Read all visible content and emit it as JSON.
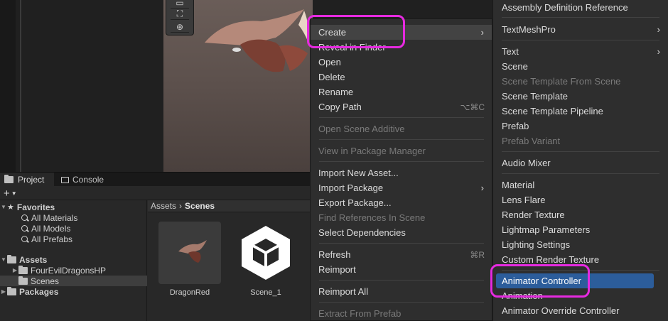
{
  "project_panel": {
    "tabs": [
      {
        "label": "Project"
      },
      {
        "label": "Console"
      }
    ],
    "add_button": "+",
    "tree": {
      "favorites": {
        "label": "Favorites",
        "items": [
          "All Materials",
          "All Models",
          "All Prefabs"
        ]
      },
      "assets": {
        "label": "Assets",
        "items": [
          "FourEvilDragonsHP",
          "Scenes"
        ]
      },
      "packages": {
        "label": "Packages"
      }
    },
    "breadcrumb": {
      "root": "Assets",
      "separator": "›",
      "current": "Scenes"
    },
    "assets": [
      {
        "label": "DragonRed"
      },
      {
        "label": "Scene_1"
      }
    ]
  },
  "context_menu": {
    "items": [
      {
        "label": "Create",
        "submenu": true
      },
      {
        "label": "Reveal in Finder"
      },
      {
        "label": "Open"
      },
      {
        "label": "Delete"
      },
      {
        "label": "Rename"
      },
      {
        "label": "Copy Path",
        "shortcut": "⌥⌘C"
      },
      {
        "label": "Open Scene Additive",
        "disabled": true
      },
      {
        "label": "View in Package Manager",
        "disabled": true
      },
      {
        "label": "Import New Asset..."
      },
      {
        "label": "Import Package",
        "submenu": true
      },
      {
        "label": "Export Package..."
      },
      {
        "label": "Find References In Scene",
        "disabled": true
      },
      {
        "label": "Select Dependencies"
      },
      {
        "label": "Refresh",
        "shortcut": "⌘R"
      },
      {
        "label": "Reimport"
      },
      {
        "label": "Reimport All"
      },
      {
        "label": "Extract From Prefab",
        "disabled": true
      }
    ]
  },
  "create_submenu": {
    "items": [
      {
        "label": "Assembly Definition Reference"
      },
      {
        "label": "TextMeshPro",
        "submenu": true
      },
      {
        "label": "Text",
        "submenu": true
      },
      {
        "label": "Scene"
      },
      {
        "label": "Scene Template From Scene",
        "disabled": true
      },
      {
        "label": "Scene Template"
      },
      {
        "label": "Scene Template Pipeline"
      },
      {
        "label": "Prefab"
      },
      {
        "label": "Prefab Variant",
        "disabled": true
      },
      {
        "label": "Audio Mixer"
      },
      {
        "label": "Material"
      },
      {
        "label": "Lens Flare"
      },
      {
        "label": "Render Texture"
      },
      {
        "label": "Lightmap Parameters"
      },
      {
        "label": "Lighting Settings"
      },
      {
        "label": "Custom Render Texture"
      },
      {
        "label": "Animator Controller",
        "selected": true
      },
      {
        "label": "Animation"
      },
      {
        "label": "Animator Override Controller"
      }
    ]
  },
  "colors": {
    "highlight": "#e62ae0",
    "selection": "#2c5d9b",
    "menu_bg": "#2e2e2e"
  }
}
